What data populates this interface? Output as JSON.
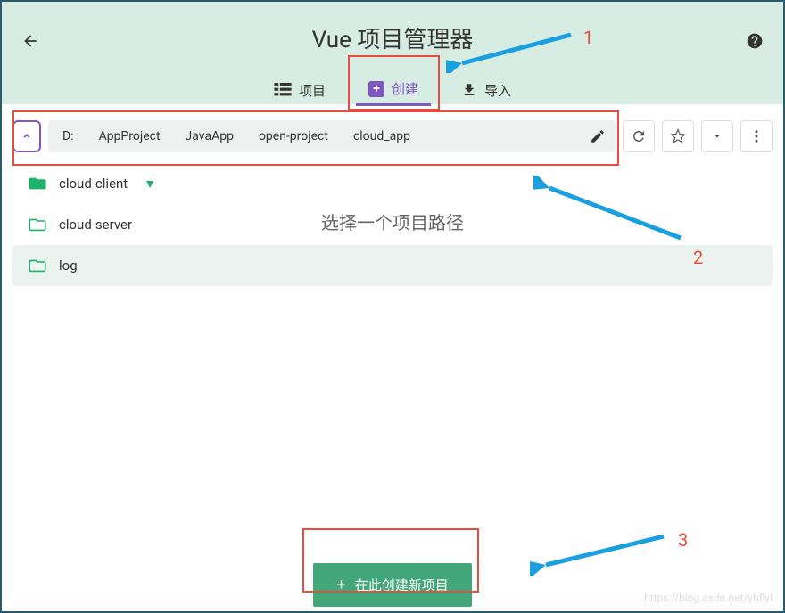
{
  "header": {
    "title": "Vue 项目管理器",
    "tabs": [
      {
        "label": "项目",
        "icon": "list-icon"
      },
      {
        "label": "创建",
        "icon": "plus-icon"
      },
      {
        "label": "导入",
        "icon": "import-icon"
      }
    ]
  },
  "breadcrumb": {
    "segments": [
      "D:",
      "AppProject",
      "JavaApp",
      "open-project",
      "cloud_app"
    ]
  },
  "subtitle": "选择一个项目路径",
  "files": [
    {
      "name": "cloud-client",
      "filled": true,
      "vue": true,
      "highlighted": false
    },
    {
      "name": "cloud-server",
      "filled": false,
      "vue": false,
      "highlighted": false
    },
    {
      "name": "log",
      "filled": false,
      "vue": false,
      "highlighted": true
    }
  ],
  "footer": {
    "create_label": "在此创建新项目"
  },
  "annotations": {
    "n1": "1",
    "n2": "2",
    "n3": "3"
  },
  "watermark": "https://blog.csdn.net/yhflyl"
}
